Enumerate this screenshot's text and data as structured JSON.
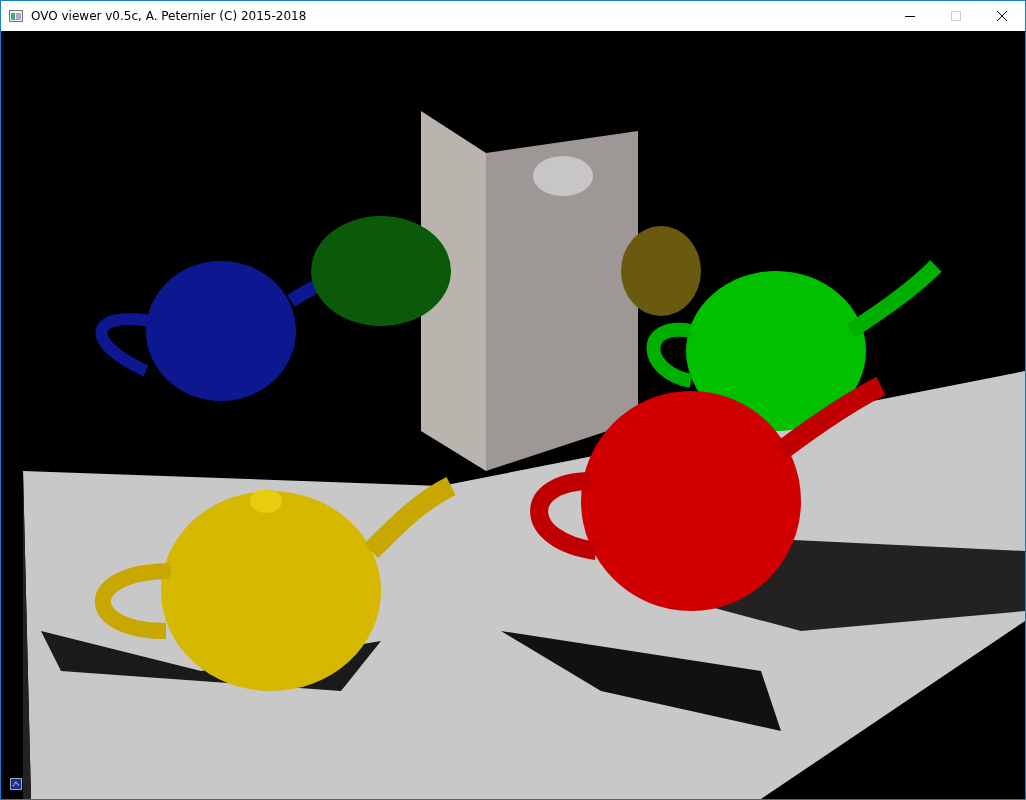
{
  "window": {
    "title": "OVO viewer v0.5c, A. Peternier (C) 2015-2018"
  },
  "window_buttons": [
    {
      "kind": "minimize",
      "disabled": false
    },
    {
      "kind": "maximize",
      "disabled": true
    },
    {
      "kind": "close",
      "disabled": false
    }
  ]
}
